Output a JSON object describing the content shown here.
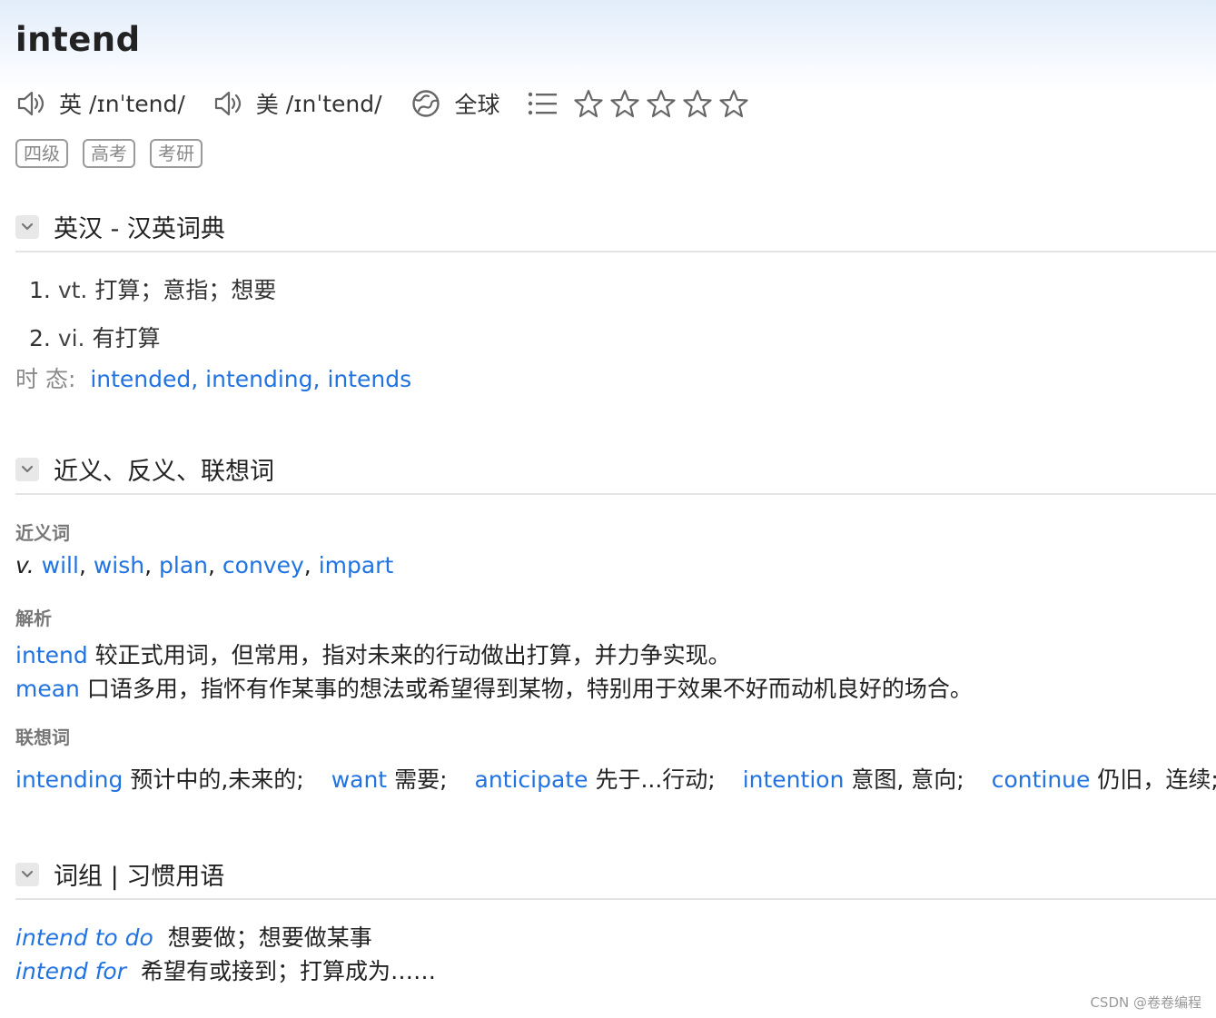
{
  "word": "intend",
  "pronunciation": {
    "uk_label": "英",
    "uk_ipa": "/ɪnˈtend/",
    "us_label": "美",
    "us_ipa": "/ɪnˈtend/",
    "global_label": "全球"
  },
  "rating": {
    "stars_filled": 0,
    "stars_total": 5
  },
  "tags": [
    "四级",
    "高考",
    "考研"
  ],
  "sections": {
    "dict": {
      "title": "英汉 - 汉英词典",
      "definitions": [
        {
          "num": "1.",
          "pos": "vt.",
          "meaning": "打算；意指；想要"
        },
        {
          "num": "2.",
          "pos": "vi.",
          "meaning": "有打算"
        }
      ],
      "tense_label": "时 态:",
      "tenses": [
        "intended",
        "intending",
        "intends"
      ]
    },
    "synonyms": {
      "title": "近义、反义、联想词",
      "syn_label": "近义词",
      "syn_pos": "v.",
      "syn_words": [
        "will",
        "wish",
        "plan",
        "convey",
        "impart"
      ],
      "analysis_label": "解析",
      "analysis": [
        {
          "word": "intend",
          "text": "较正式用词，但常用，指对未来的行动做出打算，并力争实现。"
        },
        {
          "word": "mean",
          "text": "口语多用，指怀有作某事的想法或希望得到某物，特别用于效果不好而动机良好的场合。"
        }
      ],
      "assoc_label": "联想词",
      "assoc": [
        {
          "word": "intending",
          "meaning": "预计中的,未来的;"
        },
        {
          "word": "want",
          "meaning": "需要;"
        },
        {
          "word": "anticipate",
          "meaning": "先于...行动;"
        },
        {
          "word": "intention",
          "meaning": "意图, 意向;"
        },
        {
          "word": "continue",
          "meaning": "仍旧，连续;"
        }
      ]
    },
    "phrases": {
      "title": "词组 | 习惯用语",
      "items": [
        {
          "phrase": "intend to do",
          "meaning": "想要做；想要做某事"
        },
        {
          "phrase": "intend for",
          "meaning": "希望有或接到；打算成为……"
        }
      ]
    }
  },
  "watermark": "CSDN @卷卷编程",
  "colors": {
    "link": "#2173e0",
    "header_bg": "#e2edfb"
  }
}
